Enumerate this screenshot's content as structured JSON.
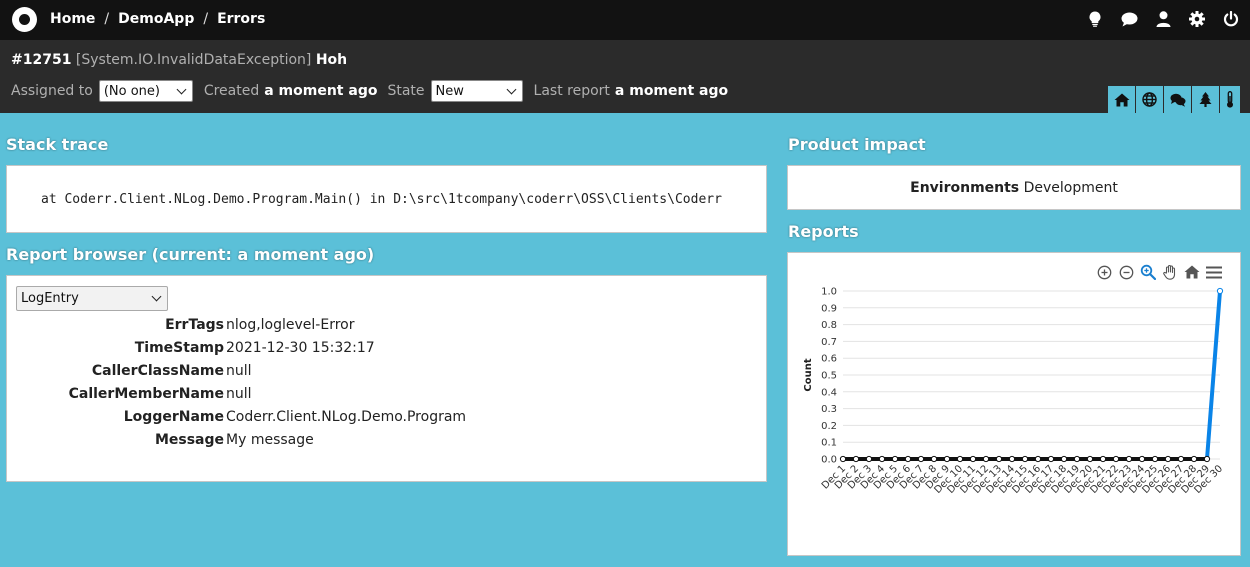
{
  "nav": {
    "breadcrumb": [
      "Home",
      "DemoApp",
      "Errors"
    ],
    "icons": [
      "lightbulb-icon",
      "chat-icon",
      "user-icon",
      "gear-icon",
      "power-icon"
    ]
  },
  "incident": {
    "id": "#12751",
    "exception": "[System.IO.InvalidDataException]",
    "title": "Hoh",
    "assigned_label": "Assigned to",
    "assigned_value": "(No one)",
    "created_label": "Created",
    "created_value": "a moment ago",
    "state_label": "State",
    "state_value": "New",
    "last_report_label": "Last report",
    "last_report_value": "a moment ago"
  },
  "tabs": [
    "home-icon",
    "globe-icon",
    "comments-icon",
    "tree-icon",
    "thermometer-icon"
  ],
  "stack": {
    "title": "Stack trace",
    "text": "at Coderr.Client.NLog.Demo.Program.Main() in D:\\src\\1tcompany\\coderr\\OSS\\Clients\\Coderr"
  },
  "browser": {
    "title": "Report browser (current: a moment ago)",
    "selected": "LogEntry",
    "rows": [
      {
        "key": "ErrTags",
        "value": "nlog,loglevel-Error"
      },
      {
        "key": "TimeStamp",
        "value": "2021-12-30 15:32:17"
      },
      {
        "key": "CallerClassName",
        "value": "null"
      },
      {
        "key": "CallerMemberName",
        "value": "null"
      },
      {
        "key": "LoggerName",
        "value": "Coderr.Client.NLog.Demo.Program"
      },
      {
        "key": "Message",
        "value": "My message"
      }
    ]
  },
  "impact": {
    "title": "Product impact",
    "label": "Environments",
    "value": "Development"
  },
  "reports": {
    "title": "Reports",
    "toolbar_icons": [
      "zoom-in-icon",
      "zoom-out-icon",
      "magnify-icon",
      "pan-hand-icon",
      "home-icon",
      "menu-icon"
    ]
  },
  "chart_data": {
    "type": "line",
    "ylabel": "Count",
    "xlabel": "",
    "ylim": [
      0,
      1
    ],
    "y_ticks": [
      "0.0",
      "0.1",
      "0.2",
      "0.3",
      "0.4",
      "0.5",
      "0.6",
      "0.7",
      "0.8",
      "0.9",
      "1.0"
    ],
    "categories": [
      "Dec 1",
      "Dec 2",
      "Dec 3",
      "Dec 4",
      "Dec 5",
      "Dec 6",
      "Dec 7",
      "Dec 8",
      "Dec 9",
      "Dec 10",
      "Dec 11",
      "Dec 12",
      "Dec 13",
      "Dec 14",
      "Dec 15",
      "Dec 16",
      "Dec 17",
      "Dec 18",
      "Dec 19",
      "Dec 20",
      "Dec 21",
      "Dec 22",
      "Dec 23",
      "Dec 24",
      "Dec 25",
      "Dec 26",
      "Dec 27",
      "Dec 28",
      "Dec 29",
      "Dec 30"
    ],
    "series": [
      {
        "values": [
          0,
          0,
          0,
          0,
          0,
          0,
          0,
          0,
          0,
          0,
          0,
          0,
          0,
          0,
          0,
          0,
          0,
          0,
          0,
          0,
          0,
          0,
          0,
          0,
          0,
          0,
          0,
          0,
          0,
          1
        ],
        "color": "#0a84e8"
      }
    ]
  }
}
